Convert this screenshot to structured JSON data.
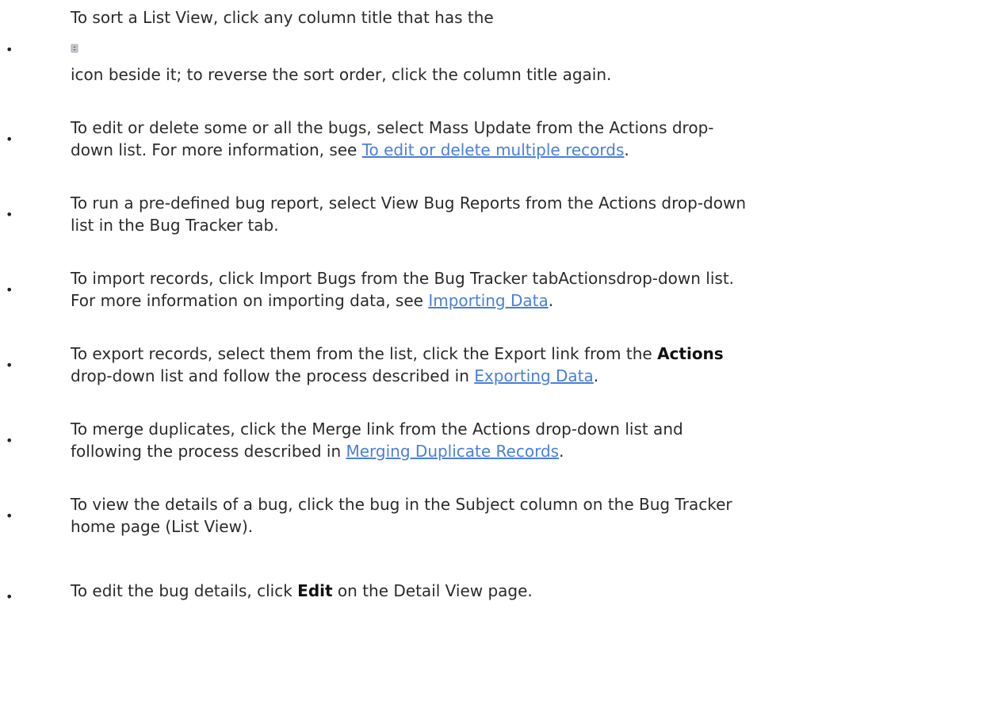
{
  "items": [
    {
      "line1": "To sort a List View, click any column title that has the",
      "icon": "sort-icon",
      "line2": "icon beside it; to reverse the sort order, click the column title again."
    },
    {
      "line1": "To edit or delete some or all the bugs, select Mass Update from the Actions drop-",
      "line2_before": "down list. For more information, see ",
      "link": "To edit or delete multiple records",
      "line2_after": "."
    },
    {
      "line1": "To run a pre-defined bug report, select View Bug Reports from the Actions drop-down",
      "line2": "list in the Bug Tracker tab."
    },
    {
      "line1": "To import records, click Import Bugs from the Bug Tracker tabActionsdrop-down list.",
      "line2_before": "For more information on importing data, see ",
      "link": "Importing Data",
      "line2_after": "."
    },
    {
      "line1_before": "To export records, select them from the list, click the Export link from the ",
      "line1_bold": "Actions",
      "line2_before": "drop-down list and follow the process described in ",
      "link": "Exporting Data",
      "line2_after": "."
    },
    {
      "line1": "To merge duplicates, click the Merge link from the Actions drop-down list and",
      "line2_before": "following the process described in ",
      "link": "Merging Duplicate Records",
      "line2_after": "."
    },
    {
      "line1": "To view the details of a bug, click the bug in the Subject column on the Bug Tracker",
      "line2": "home page (List View)."
    },
    {
      "line1_before": "To edit the bug details, click ",
      "line1_bold": "Edit",
      "line1_after": " on the Detail View page."
    }
  ]
}
